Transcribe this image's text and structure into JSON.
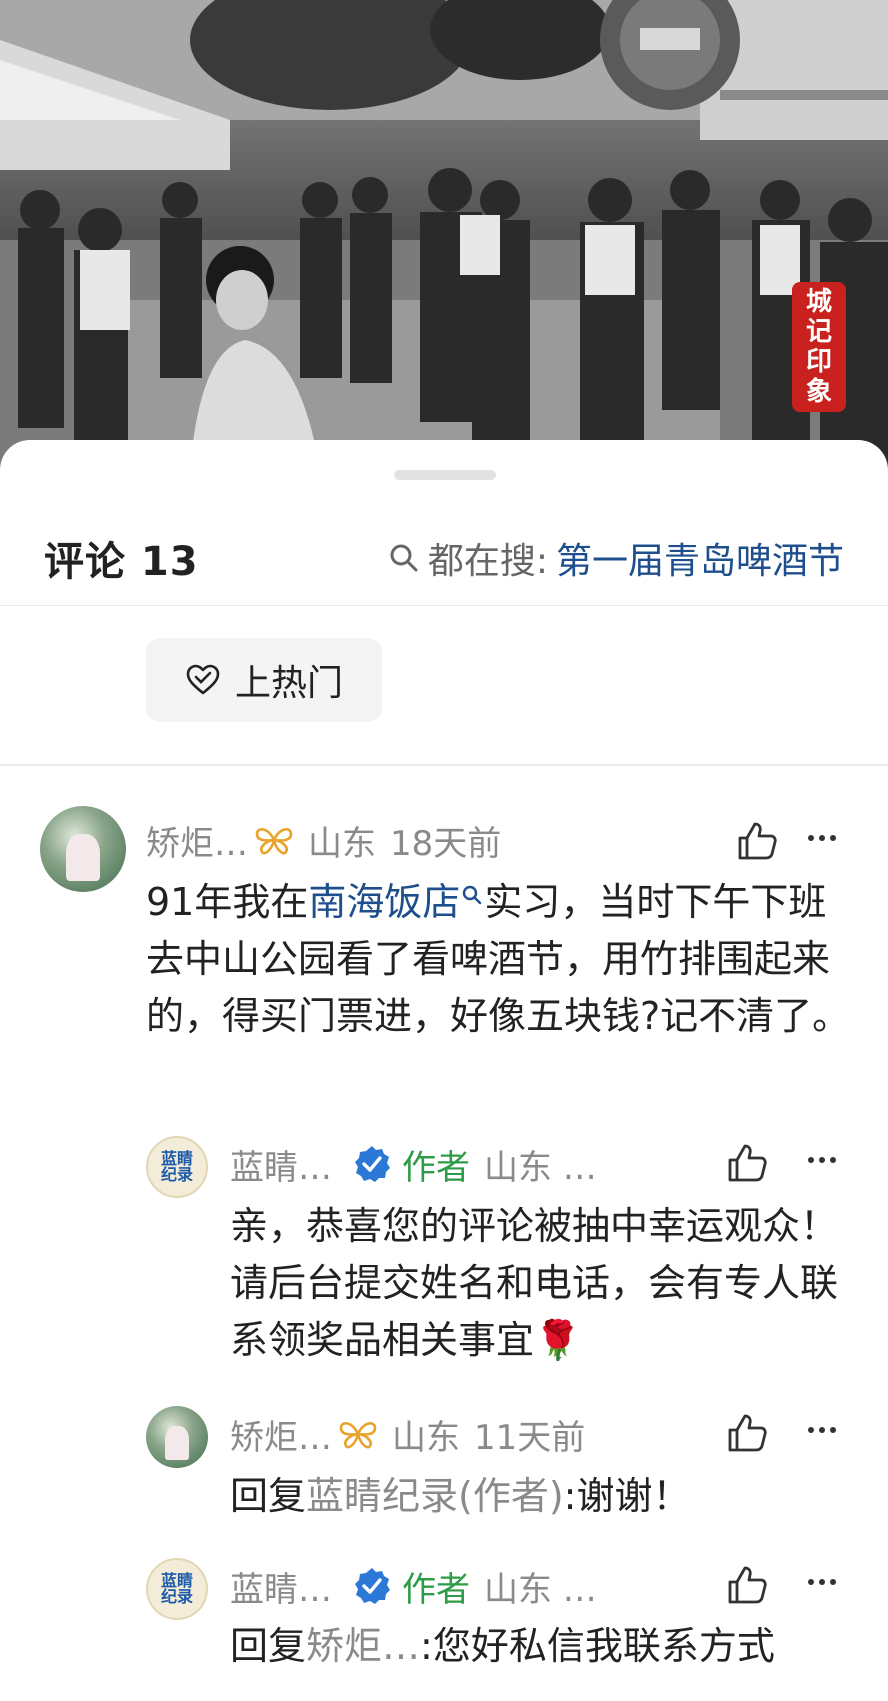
{
  "hero": {
    "stamp_text": [
      "城",
      "记",
      "印",
      "象"
    ]
  },
  "header": {
    "comments_label": "评论 13",
    "trending_prefix": "都在搜:",
    "trending_topic": "第一届青岛啤酒节"
  },
  "hot_button": {
    "label": "上热门"
  },
  "comments": [
    {
      "user": "矫炬…",
      "location": "山东",
      "time": "18天前",
      "text_before_link": "91年我在",
      "link_text": "南海饭店",
      "text_after_link": "实习，当时下午下班去中山公园看了看啤酒节，用竹排围起来的，得买门票进，好像五块钱?记不清了。"
    },
    {
      "user": "蓝睛…",
      "author_tag": "作者",
      "location": "山东 …",
      "avatar_text": [
        "蓝睛",
        "纪录"
      ],
      "text": "亲，恭喜您的评论被抽中幸运观众！请后台提交姓名和电话，会有专人联系领奖品相关事宜🌹"
    },
    {
      "user": "矫炬…",
      "location": "山东",
      "time": "11天前",
      "reply_prefix": "回复",
      "reply_target": "蓝睛纪录(作者)",
      "reply_text": ":谢谢！"
    },
    {
      "user": "蓝睛…",
      "author_tag": "作者",
      "location": "山东 …",
      "avatar_text": [
        "蓝睛",
        "纪录"
      ],
      "reply_prefix": "回复",
      "reply_target": "矫炬…",
      "reply_text": ":您好私信我联系方式"
    }
  ]
}
